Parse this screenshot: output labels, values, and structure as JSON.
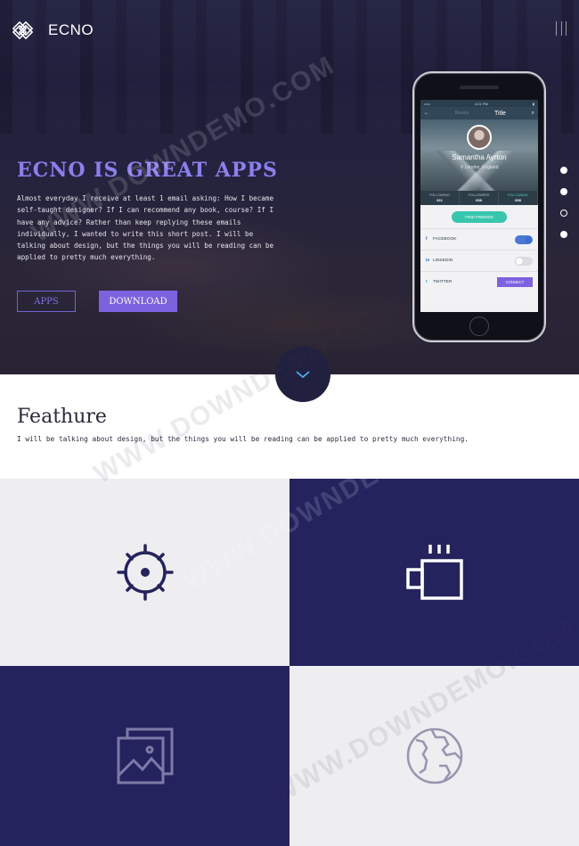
{
  "brand": {
    "name": "ECNO",
    "icon": "knot-logo-icon"
  },
  "hero": {
    "title": "ECNO IS GREAT APPS",
    "text": "Almost everyday I receive at least 1 email asking: How I became self-taught designer? If I can recommend any book, course? If I have any advice? Rather than keep replying these emails individually, I wanted to write this short post. I will be talking about design, but the things you will be reading can be applied to pretty much everything.",
    "buttons": {
      "apps": "APPS",
      "download": "DOWNLOAD"
    },
    "pager": {
      "count": 4,
      "active_index": 2
    }
  },
  "phone": {
    "status_left": "•••••",
    "status_time": "4:21 PM",
    "app_bar_title": "Title",
    "app_bar_left": "Beauty",
    "profile_name": "Samantha Ayrton",
    "profile_location": "London, England",
    "stats": [
      {
        "label": "FOLLOWING",
        "value": "321"
      },
      {
        "label": "FOLLOWERS",
        "value": "658"
      },
      {
        "label": "FOLLOWING",
        "value": "658"
      }
    ],
    "find_friends": "FIND FRIENDS",
    "social": [
      {
        "icon": "facebook-icon",
        "label": "FACEBOOK",
        "control": "toggle-on"
      },
      {
        "icon": "linkedin-icon",
        "label": "LINKEDIN",
        "control": "toggle-off"
      },
      {
        "icon": "twitter-icon",
        "label": "TWITTER",
        "control": "CONNECT"
      }
    ]
  },
  "feature": {
    "title": "Feathure",
    "text": "I will be talking about design, but the things you will be reading can be applied to pretty much everything."
  },
  "tiles": [
    {
      "icon": "sun-gear-icon",
      "theme": "light"
    },
    {
      "icon": "coffee-cup-icon",
      "theme": "dark"
    },
    {
      "icon": "image-gallery-icon",
      "theme": "dark"
    },
    {
      "icon": "globe-icon",
      "theme": "light"
    }
  ],
  "colors": {
    "accent": "#7d62e0",
    "navy": "#25235e",
    "light_tile": "#eeeef1",
    "hero_title": "#8b7ff0"
  },
  "watermark": "WWW.DOWNDEMO.COM"
}
